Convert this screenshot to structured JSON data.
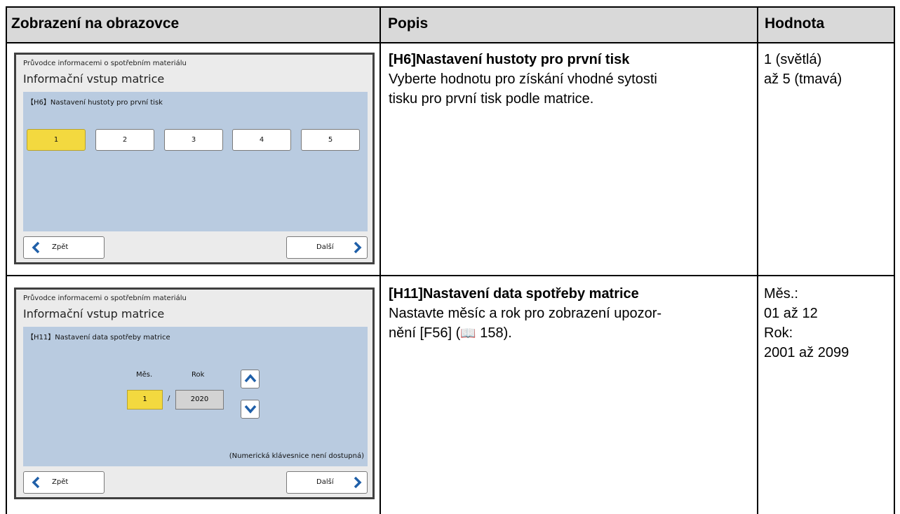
{
  "table": {
    "headers": [
      "Zobrazení na obrazovce",
      "Popis",
      "Hodnota"
    ],
    "rows": [
      {
        "screen": {
          "subtitle": "Průvodce informacemi o spotřebním materiálu",
          "title": "Informační vstup matrice",
          "panel_label": "【H6】Nastavení hustoty pro první tisk",
          "levels": [
            "1",
            "2",
            "3",
            "4",
            "5"
          ],
          "selected_level": "1",
          "back_label": "Zpět",
          "next_label": "Další"
        },
        "description": {
          "heading": "[H6]Nastavení hustoty pro první tisk",
          "line1": "Vyberte hodnotu pro získání vhodné sytosti",
          "line2": "tisku pro první tisk podle matrice."
        },
        "value": [
          "1 (světlá)",
          "až 5 (tmavá)"
        ]
      },
      {
        "screen": {
          "subtitle": "Průvodce informacemi o spotřebním materiálu",
          "title": "Informační vstup matrice",
          "panel_label": "【H11】Nastavení data spotřeby matrice",
          "month_label": "Měs.",
          "year_label": "Rok",
          "month_value": "1",
          "separator": "/",
          "year_value": "2020",
          "note": "(Numerická klávesnice není dostupná)",
          "back_label": "Zpět",
          "next_label": "Další"
        },
        "description": {
          "heading": "[H11]Nastavení data spotřeby matrice",
          "line1": "Nastavte měsíc a rok pro zobrazení upozor-",
          "line2_prefix": "nění [F56] (",
          "book_icon": "📖",
          "line2_suffix": " 158)."
        },
        "value": [
          "Měs.:",
          "01 až 12",
          "Rok:",
          "2001 až 2099"
        ]
      }
    ]
  },
  "colors": {
    "header_bg": "#d9d9d9",
    "panel_bg": "#b9cbe0",
    "selected": "#f3d93f",
    "arrow": "#1f5fa8"
  }
}
